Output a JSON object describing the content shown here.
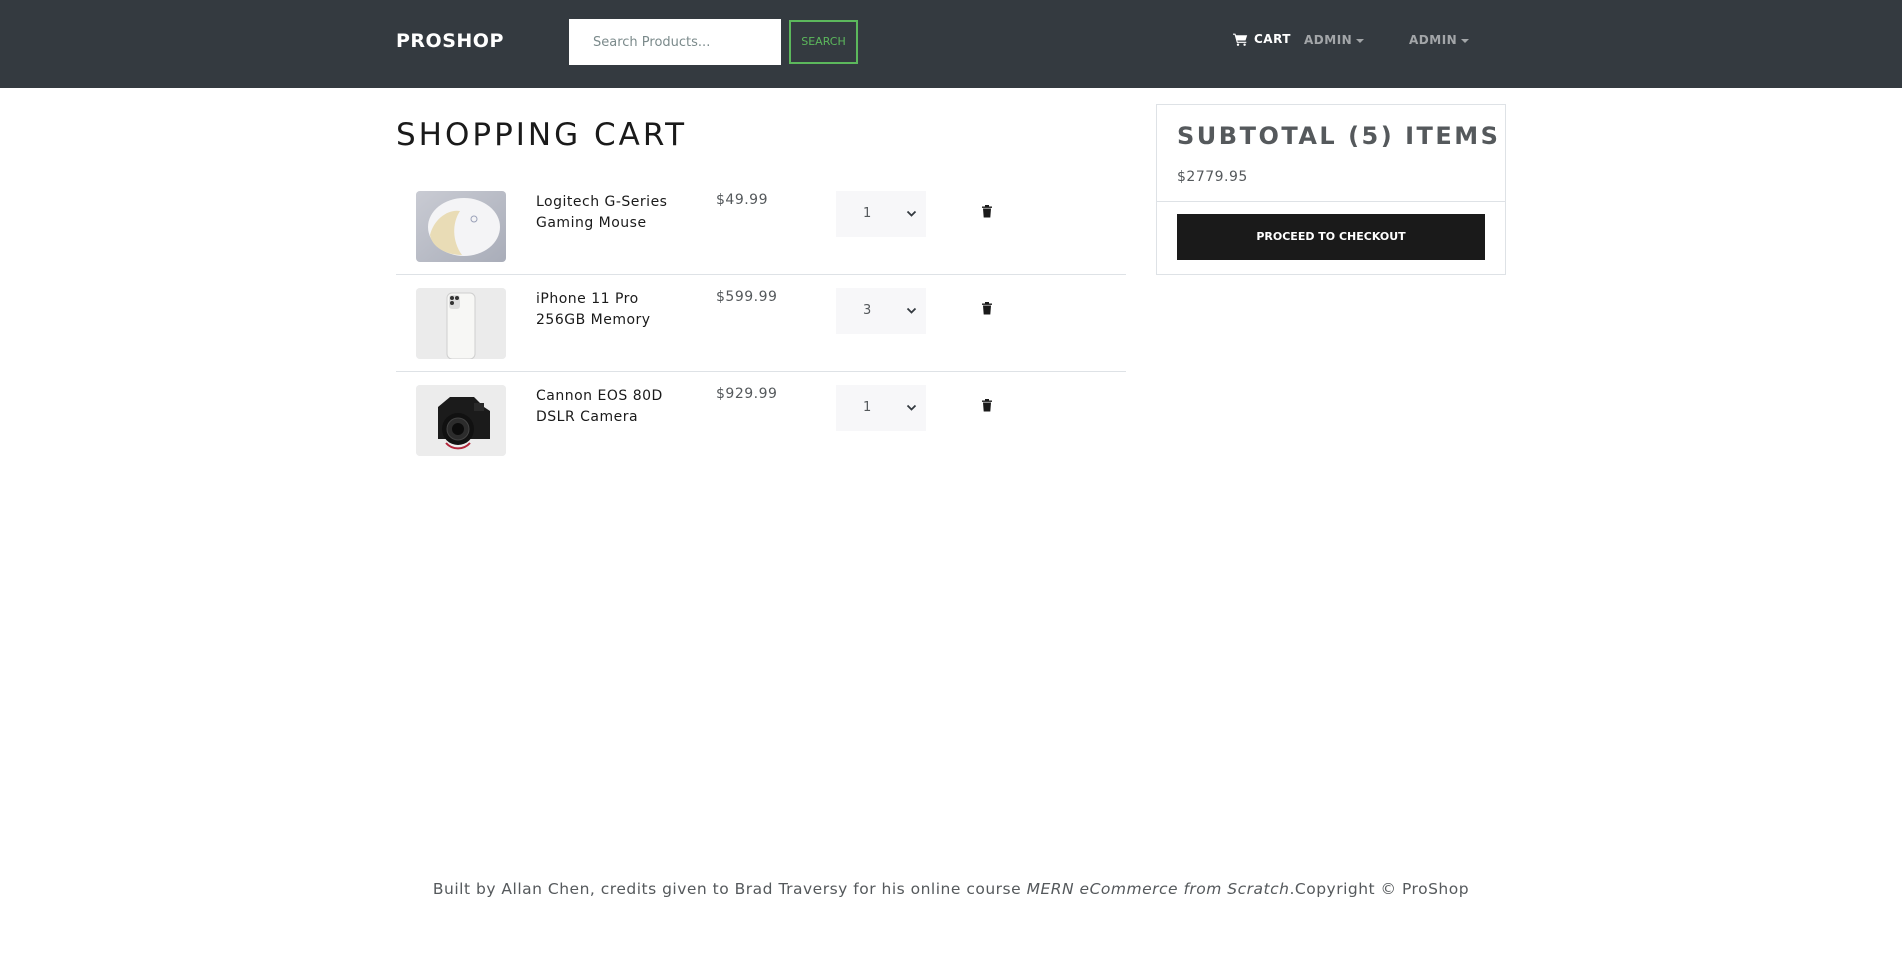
{
  "navbar": {
    "brand": "PROSHOP",
    "search": {
      "placeholder": "Search Products...",
      "value": "",
      "button_label": "SEARCH"
    },
    "cart_label": "CART",
    "menus": [
      {
        "label": "ADMIN"
      },
      {
        "label": "ADMIN"
      }
    ]
  },
  "cart": {
    "title": "SHOPPING CART",
    "items": [
      {
        "name": "Logitech G-Series Gaming Mouse",
        "price": "$49.99",
        "qty": "1",
        "image": "mouse"
      },
      {
        "name": "iPhone 11 Pro 256GB Memory",
        "price": "$599.99",
        "qty": "3",
        "image": "phone"
      },
      {
        "name": "Cannon EOS 80D DSLR Camera",
        "price": "$929.99",
        "qty": "1",
        "image": "camera"
      }
    ]
  },
  "summary": {
    "heading": "SUBTOTAL (5) ITEMS",
    "total": "$2779.95",
    "checkout_label": "PROCEED TO CHECKOUT"
  },
  "footer": {
    "text_before": "Built by Allan Chen, credits given to Brad Traversy for his online course ",
    "course": "MERN eCommerce from Scratch",
    "text_after": ".Copyright © ProShop"
  },
  "colors": {
    "navbar_bg": "#343a40",
    "search_accent": "#5cb85c",
    "checkout_bg": "#1a1a1a"
  },
  "icons": {
    "cart": "shopping-cart-icon",
    "remove": "trash-icon",
    "select": "chevron-down-icon",
    "dropdown": "caret-down-icon"
  }
}
